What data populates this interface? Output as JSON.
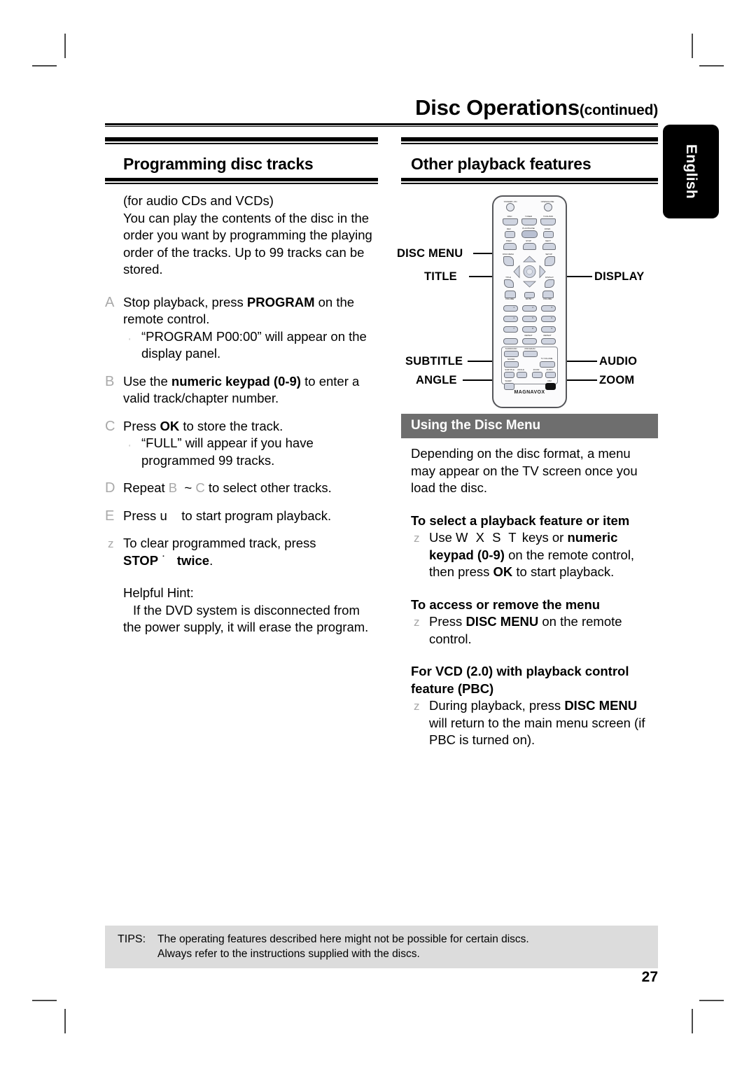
{
  "page": {
    "chapter_title": "Disc Operations",
    "chapter_continued": "(continued)",
    "language_tab": "English",
    "page_number": "27"
  },
  "left_column": {
    "section_title": "Programming disc tracks",
    "intro_line_1": "(for audio CDs and VCDs)",
    "intro_line_2": "You can play the contents of the disc in the order you want by programming the playing order of the tracks. Up to 99 tracks can be stored.",
    "steps": [
      {
        "marker": "A",
        "text_before": "Stop playback, press ",
        "bold": "PROGRAM",
        "text_after": " on the remote control.",
        "sub_bullet": "“PROGRAM P00:00” will appear on the display panel."
      },
      {
        "marker": "B",
        "text_before": "Use the ",
        "bold": "numeric keypad (0-9)",
        "text_after": " to enter a valid track/chapter number.",
        "sub_bullet": ""
      },
      {
        "marker": "C",
        "text_before": "Press ",
        "bold": "OK",
        "text_after": " to store the track.",
        "sub_bullet": "“FULL” will appear if you have programmed 99 tracks."
      },
      {
        "marker": "D",
        "text_before": "Repeat ",
        "bold": "",
        "text_after": " to select other tracks.",
        "ref_first": "B",
        "ref_sep": "~",
        "ref_second": "C",
        "sub_bullet": ""
      },
      {
        "marker": "E",
        "text_before": "Press ",
        "bold": "",
        "text_after": " to start program playback.",
        "key_glyph": "u",
        "sub_bullet": ""
      }
    ],
    "clear_note": {
      "marker": "z",
      "text_before": "To clear programmed track, press ",
      "bold": "STOP",
      "glyph": "˙",
      "bold_after": "twice",
      "text_after": "."
    },
    "helpful_hint_label": "Helpful Hint:",
    "helpful_hint_text": "If the DVD system is disconnected from the power supply, it will erase the program."
  },
  "right_column": {
    "section_title": "Other playback features",
    "remote": {
      "brand": "MAGNAVOX",
      "callouts": [
        {
          "label": "DISC MENU",
          "side": "left"
        },
        {
          "label": "TITLE",
          "side": "left"
        },
        {
          "label": "SUBTITLE",
          "side": "left"
        },
        {
          "label": "ANGLE",
          "side": "left"
        },
        {
          "label": "DISPLAY",
          "side": "right"
        },
        {
          "label": "AUDIO",
          "side": "right"
        },
        {
          "label": "ZOOM",
          "side": "right"
        }
      ],
      "button_labels": [
        "STANDBY·ON",
        "OPEN/CLOSE",
        "DISC",
        "TUNER",
        "TV/AUX/DI",
        "REV",
        "PLAY/PAUSE",
        "FFWD",
        "PREV",
        "STOP",
        "NEXT",
        "DISC MENU",
        "SETUP",
        "TITLE",
        "DISPLAY",
        "VOLUME",
        "MUTE",
        "VOLUME",
        "1",
        "2",
        "3",
        "4",
        "5",
        "6",
        "7",
        "8",
        "9",
        "REPEAT",
        "REPEAT",
        "0",
        "SURROUND",
        "PROGRAM",
        "SOUND",
        "TV VOLUME",
        "SUBTITLE",
        "ANGLE",
        "ZOOM",
        "AUDIO",
        "SLEEP",
        "DIM"
      ]
    },
    "disc_menu_bar": "Using the Disc Menu",
    "disc_menu_intro": "Depending on the disc format, a menu may appear on the TV screen once you load the disc.",
    "blocks": [
      {
        "heading": "To select a playback feature or item",
        "marker": "z",
        "text_1": "Use ",
        "keys": "W X S T",
        "text_2": " keys or ",
        "bold_1": "numeric keypad (0-9)",
        "text_3": " on the remote control, then press ",
        "bold_2": "OK",
        "text_4": " to start playback."
      },
      {
        "heading": "To access or remove the menu",
        "marker": "z",
        "text_1": "Press ",
        "bold_1": "DISC MENU",
        "text_2": " on the remote control.",
        "keys": "",
        "text_3": "",
        "bold_2": "",
        "text_4": ""
      },
      {
        "heading": "For VCD (2.0) with playback control feature (PBC)",
        "marker": "z",
        "text_1": "During playback, press ",
        "bold_1": "DISC MENU",
        "text_2": " will return to the main menu screen (if PBC is turned on).",
        "keys": "",
        "text_3": "",
        "bold_2": "",
        "text_4": ""
      }
    ]
  },
  "footer": {
    "tips_label": "TIPS:",
    "tips_line_1": "The operating features described here might not be possible for certain discs.",
    "tips_line_2": "Always refer to the instructions supplied with the discs."
  }
}
